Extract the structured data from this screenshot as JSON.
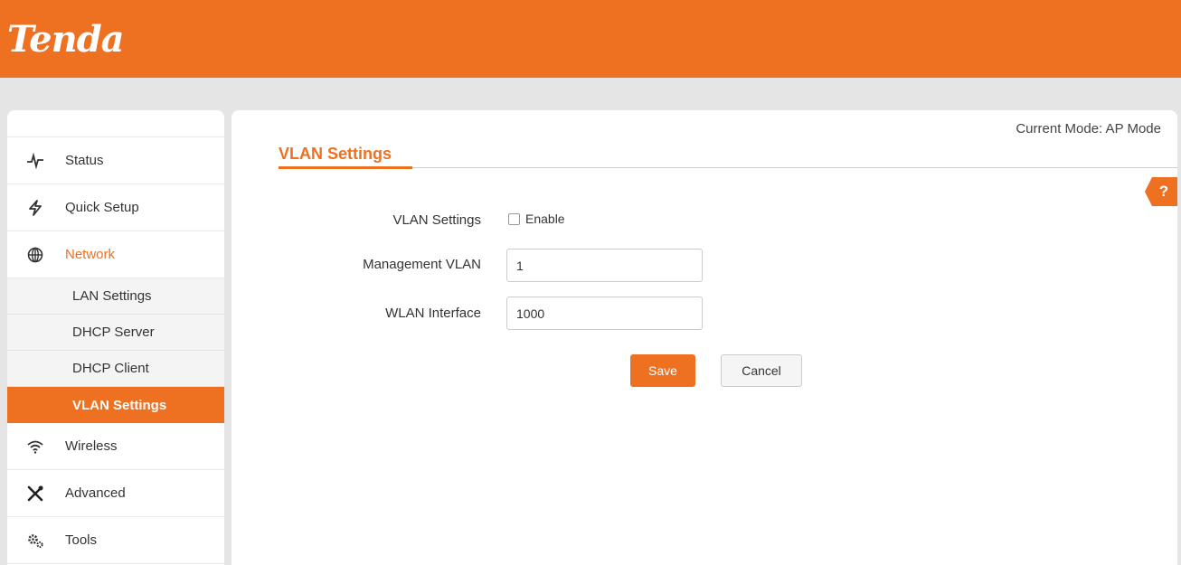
{
  "brand": {
    "logo_text": "Tenda",
    "color": "#ee7021"
  },
  "sidebar": {
    "items": [
      {
        "label": "Status",
        "icon": "pulse-icon"
      },
      {
        "label": "Quick Setup",
        "icon": "lightning-icon"
      },
      {
        "label": "Network",
        "icon": "globe-icon",
        "active": true
      },
      {
        "label": "Wireless",
        "icon": "wifi-icon"
      },
      {
        "label": "Advanced",
        "icon": "tools-cross-icon"
      },
      {
        "label": "Tools",
        "icon": "gears-icon"
      }
    ],
    "network_subitems": [
      {
        "label": "LAN Settings"
      },
      {
        "label": "DHCP Server"
      },
      {
        "label": "DHCP Client"
      },
      {
        "label": "VLAN Settings",
        "current": true
      }
    ]
  },
  "main": {
    "current_mode": "Current Mode: AP Mode",
    "page_title": "VLAN Settings",
    "help_label": "?",
    "form": {
      "vlan_settings_label": "VLAN Settings",
      "enable_label": "Enable",
      "enable_checked": false,
      "management_vlan_label": "Management VLAN",
      "management_vlan_value": "1",
      "wlan_interface_label": "WLAN Interface",
      "wlan_interface_value": "1000"
    },
    "buttons": {
      "save": "Save",
      "cancel": "Cancel"
    }
  }
}
